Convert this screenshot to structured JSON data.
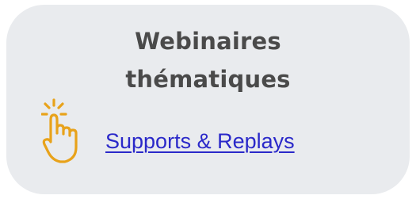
{
  "card": {
    "title_line1": "Webinaires",
    "title_line2": "thématiques",
    "link_label": "Supports & Replays"
  },
  "icons": {
    "pointer": "hand-pointer-click-icon"
  },
  "colors": {
    "card_background": "#e9ebee",
    "title": "#4a4a4a",
    "link": "#2a28c9",
    "icon": "#e8a21a"
  }
}
